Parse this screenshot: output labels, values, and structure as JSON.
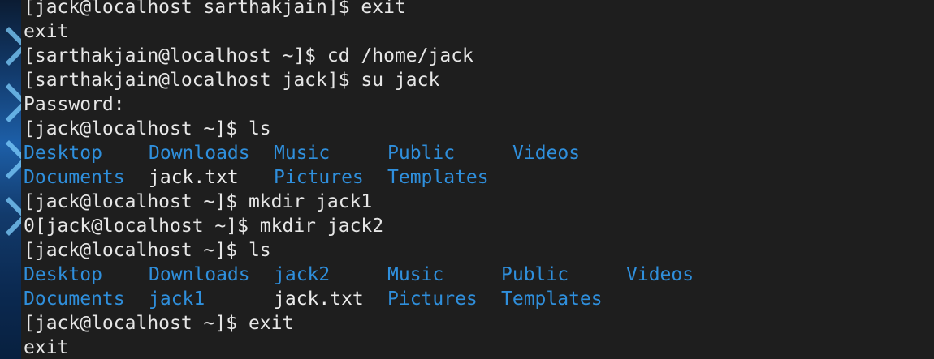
{
  "terminal": {
    "lines": [
      "[jack@localhost sarthakjain]$ exit",
      "exit",
      "[sarthakjain@localhost ~]$ cd /home/jack",
      "[sarthakjain@localhost jack]$ su jack",
      "Password:",
      "[jack@localhost ~]$ ls"
    ],
    "ls1": {
      "row1": [
        "Desktop",
        "Downloads",
        "Music",
        "Public",
        "Videos"
      ],
      "row2": [
        "Documents",
        "jack.txt",
        "Pictures",
        "Templates"
      ]
    },
    "lines2": [
      "[jack@localhost ~]$ mkdir jack1",
      "0[jack@localhost ~]$ mkdir jack2",
      "[jack@localhost ~]$ ls"
    ],
    "ls2": {
      "row1": [
        "Desktop",
        "Downloads",
        "jack2",
        "Music",
        "Public",
        "Videos"
      ],
      "row2": [
        "Documents",
        "jack1",
        "jack.txt",
        "Pictures",
        "Templates"
      ]
    },
    "lines3": [
      "[jack@localhost ~]$ exit",
      "exit"
    ]
  },
  "colors": {
    "background": "#1e1e1e",
    "text": "#e6e6e6",
    "directory": "#2f8fdc"
  }
}
